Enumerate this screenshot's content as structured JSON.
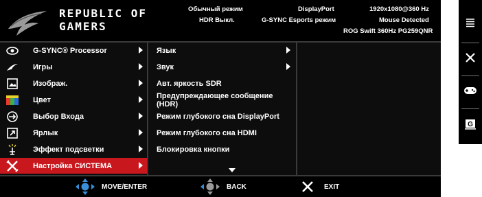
{
  "header": {
    "brand_line1": "REPUBLIC OF",
    "brand_line2": "GAMERS",
    "mode": "Обычный режим",
    "hdr": "HDR Выкл.",
    "input": "DisplayPort",
    "gsync": "G-SYNC Esports режим",
    "resolution": "1920x1080@360 Hz",
    "mouse": "Mouse Detected",
    "model": "ROG Swift 360Hz PG259QNR"
  },
  "main_menu": {
    "items": [
      {
        "label": "G-SYNC® Processor",
        "icon": "gsync-processor-icon"
      },
      {
        "label": "Игры",
        "icon": "games-icon"
      },
      {
        "label": "Изображ.",
        "icon": "image-icon"
      },
      {
        "label": "Цвет",
        "icon": "color-icon"
      },
      {
        "label": "Выбор Входа",
        "icon": "input-select-icon"
      },
      {
        "label": "Ярлык",
        "icon": "shortcut-icon"
      },
      {
        "label": "Эффект подсветки",
        "icon": "lighting-effect-icon"
      },
      {
        "label": "Настройка СИСТЕМА",
        "icon": "system-setup-icon"
      }
    ],
    "selected_index": 7,
    "selected_color": "#c8171d"
  },
  "sub_menu": {
    "items": [
      {
        "label": "Язык",
        "has_arrow": true
      },
      {
        "label": "Звук",
        "has_arrow": true
      },
      {
        "label": "Авт. яркость SDR",
        "has_arrow": false
      },
      {
        "label": "Предупреждающее сообщение (HDR)",
        "has_arrow": false
      },
      {
        "label": "Режим глубокого сна DisplayPort",
        "has_arrow": false
      },
      {
        "label": "Режим глубокого сна HDMI",
        "has_arrow": false
      },
      {
        "label": "Блокировка кнопки",
        "has_arrow": false
      }
    ]
  },
  "footer": {
    "move_label": "MOVE/ENTER",
    "back_label": "BACK",
    "exit_label": "EXIT",
    "joystick_color": "#3a8fd8"
  },
  "side_keys": [
    "menu-icon",
    "close-icon",
    "gamepad-icon",
    "gameplus-icon"
  ],
  "side_labels": {
    "gameplus": "G"
  }
}
